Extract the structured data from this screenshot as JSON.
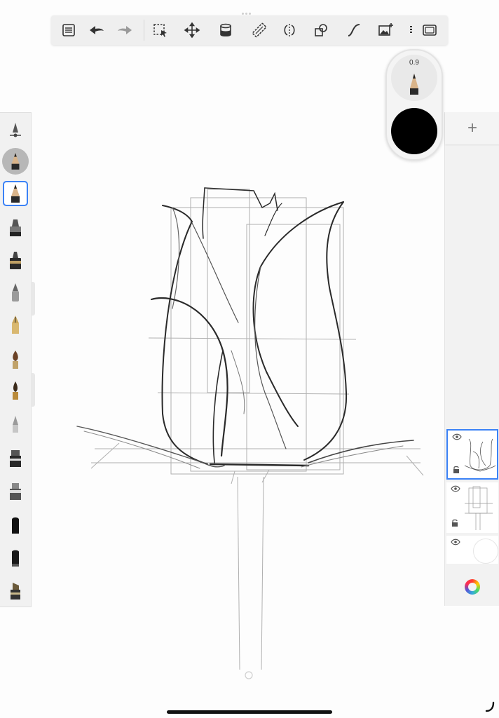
{
  "toolbar": {
    "tools": [
      {
        "icon": "layers-list-icon"
      },
      {
        "icon": "undo-icon"
      },
      {
        "icon": "redo-icon"
      },
      {
        "icon": "selection-icon"
      },
      {
        "icon": "transform-icon"
      },
      {
        "icon": "fill-bucket-icon"
      },
      {
        "icon": "ruler-icon"
      },
      {
        "icon": "symmetry-icon"
      },
      {
        "icon": "shapes-icon"
      },
      {
        "icon": "curve-icon"
      },
      {
        "icon": "image-insert-icon"
      },
      {
        "icon": "fullscreen-icon"
      }
    ]
  },
  "puck": {
    "brush_size": "0.9",
    "current_color": "#000000"
  },
  "brush_palette": {
    "brushes": [
      {
        "icon": "brush-settings-icon"
      },
      {
        "icon": "recent-pencil-icon"
      },
      {
        "icon": "pencil-brush-icon",
        "selected": true
      },
      {
        "icon": "marker-brush-icon"
      },
      {
        "icon": "ink-pen-icon"
      },
      {
        "icon": "ballpoint-icon"
      },
      {
        "icon": "fountain-pen-icon"
      },
      {
        "icon": "paintbrush-icon"
      },
      {
        "icon": "paint-round-icon"
      },
      {
        "icon": "airbrush-icon"
      },
      {
        "icon": "marker-wide-icon"
      },
      {
        "icon": "eraser-hard-icon"
      },
      {
        "icon": "blender-icon"
      },
      {
        "icon": "eraser-soft-icon"
      },
      {
        "icon": "chisel-marker-icon"
      }
    ]
  },
  "layers_panel": {
    "add_label": "+",
    "layers": [
      {
        "name": "sketch-layer",
        "visible": true,
        "selected": true
      },
      {
        "name": "guides-layer",
        "visible": true,
        "selected": false
      },
      {
        "name": "background-layer",
        "visible": true,
        "selected": false
      }
    ]
  },
  "colors": {
    "accent": "#3b82f6",
    "stroke": "#2a2a2a",
    "guide": "#a9a9a9"
  }
}
